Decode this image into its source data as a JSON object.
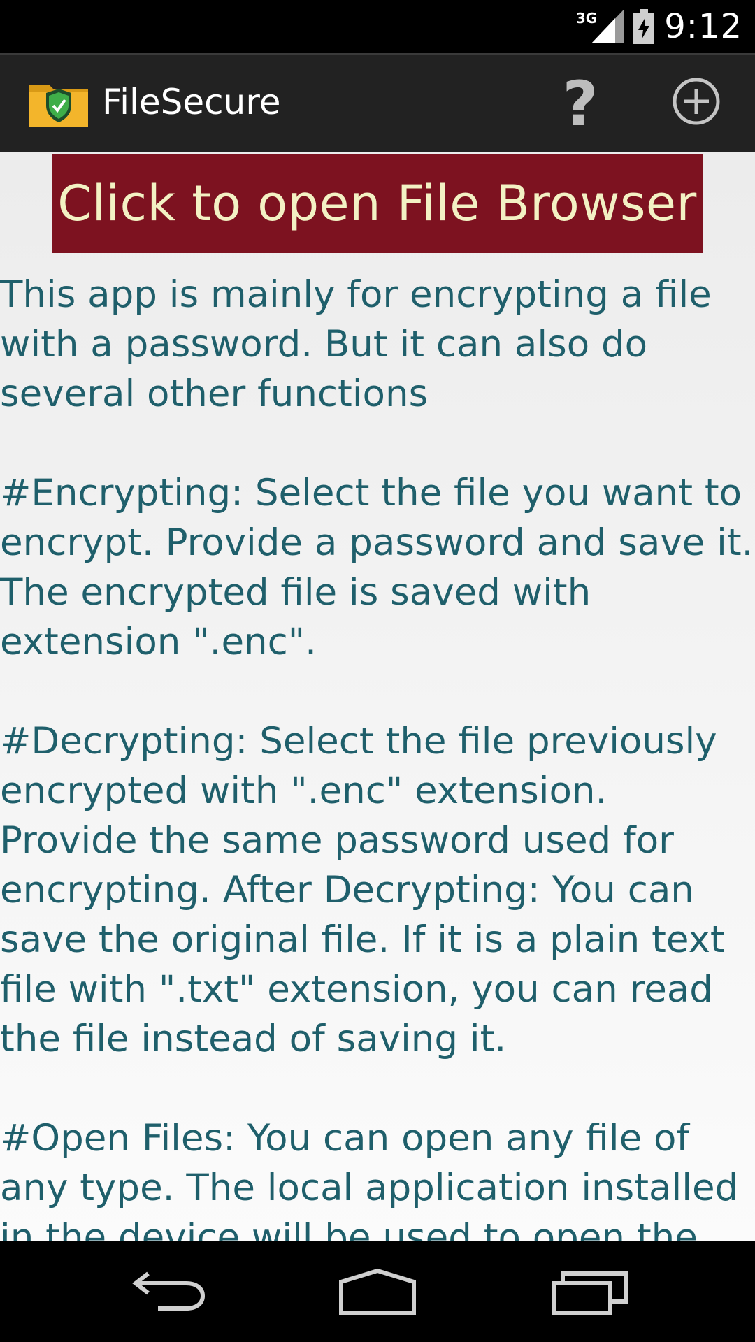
{
  "status_bar": {
    "network": "3G",
    "time": "9:12",
    "icons": [
      "signal-icon",
      "battery-charging-icon"
    ]
  },
  "action_bar": {
    "title": "FileSecure",
    "help_label": "?",
    "icons": [
      "folder-shield-icon",
      "help-icon",
      "add-circle-icon"
    ]
  },
  "main": {
    "open_button_label": "Click to open File Browser",
    "info_text": "This app is mainly for encrypting a file with a password. But it can also do several other functions\n\n#Encrypting: Select the file you want to encrypt. Provide a password and save it. The encrypted file is saved with extension \".enc\".\n\n#Decrypting: Select the file previously encrypted with \".enc\" extension. Provide the same password used for encrypting. After Decrypting: You can save the original file. If it is a plain text file with \".txt\" extension, you can read the file instead of saving it.\n\n#Open Files: You can open any file of any type. The local application installed in the device will be used to open the"
  },
  "nav_bar": {
    "icons": [
      "back-icon",
      "home-icon",
      "recent-apps-icon"
    ]
  },
  "colors": {
    "button_bg": "#7d1220",
    "button_text": "#f3f1c4",
    "body_text": "#1f5f6b",
    "action_bar": "#222222"
  }
}
